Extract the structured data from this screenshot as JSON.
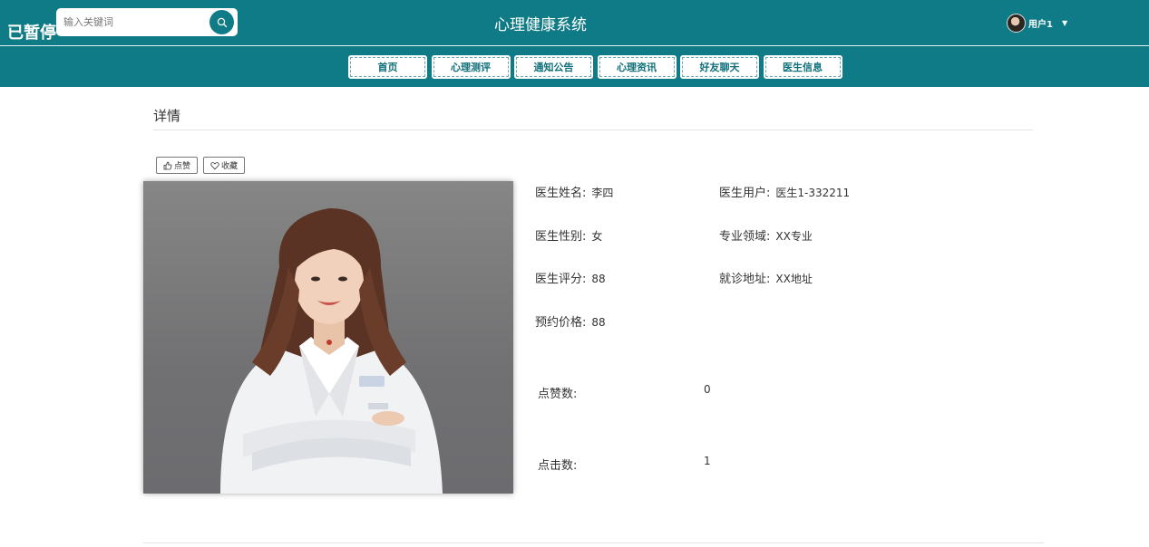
{
  "header": {
    "paused_label": "已暂停",
    "search_placeholder": "输入关键词",
    "system_title": "心理健康系统",
    "user_name": "用户1"
  },
  "nav": {
    "items": [
      {
        "label": "首页"
      },
      {
        "label": "心理测评"
      },
      {
        "label": "通知公告"
      },
      {
        "label": "心理资讯"
      },
      {
        "label": "好友聊天"
      },
      {
        "label": "医生信息"
      }
    ]
  },
  "detail": {
    "section_title": "详情",
    "like_label": "点赞",
    "favorite_label": "收藏",
    "fields": {
      "doctor_name": {
        "label": "医生姓名:",
        "value": "李四"
      },
      "doctor_user": {
        "label": "医生用户:",
        "value": "医生1-332211"
      },
      "doctor_gender": {
        "label": "医生性别:",
        "value": "女"
      },
      "specialty": {
        "label": "专业领域:",
        "value": "XX专业"
      },
      "doctor_rating": {
        "label": "医生评分:",
        "value": "88"
      },
      "clinic_address": {
        "label": "就诊地址:",
        "value": "XX地址"
      },
      "booking_price": {
        "label": "预约价格:",
        "value": "88"
      }
    },
    "likes": {
      "label": "点赞数:",
      "value": "0"
    },
    "clicks": {
      "label": "点击数:",
      "value": "1"
    }
  },
  "colors": {
    "primary": "#0f7b87",
    "background": "#ffffff"
  }
}
